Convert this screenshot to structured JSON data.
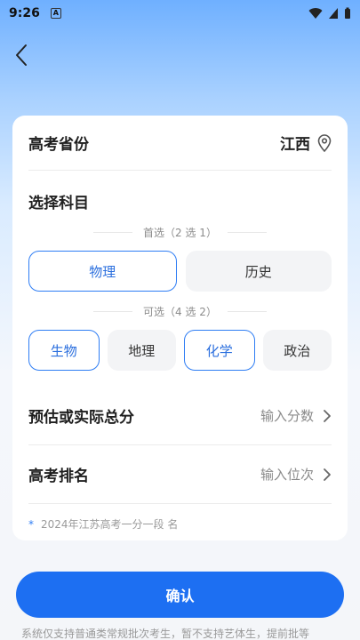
{
  "status_bar": {
    "time": "9:26",
    "notification_letter": "A"
  },
  "card": {
    "province_label": "高考省份",
    "province_value": "江西",
    "subject_title": "选择科目",
    "primary_hint": "首选（2 选 1）",
    "primary_options": [
      {
        "label": "物理",
        "selected": true
      },
      {
        "label": "历史",
        "selected": false
      }
    ],
    "secondary_hint": "可选（4 选 2）",
    "secondary_options": [
      {
        "label": "生物",
        "selected": true
      },
      {
        "label": "地理",
        "selected": false
      },
      {
        "label": "化学",
        "selected": true
      },
      {
        "label": "政治",
        "selected": false
      }
    ],
    "score_label": "预估或实际总分",
    "score_placeholder": "输入分数",
    "rank_label": "高考排名",
    "rank_placeholder": "输入位次",
    "footnote_star": "*",
    "footnote": "2024年江苏高考一分一段 名"
  },
  "confirm_label": "确认",
  "bottom_note": "系统仅支持普通类常规批次考生，暂不支持艺体生，提前批等",
  "colors": {
    "accent": "#1d6ff2",
    "selected_border": "#2e7df4"
  }
}
